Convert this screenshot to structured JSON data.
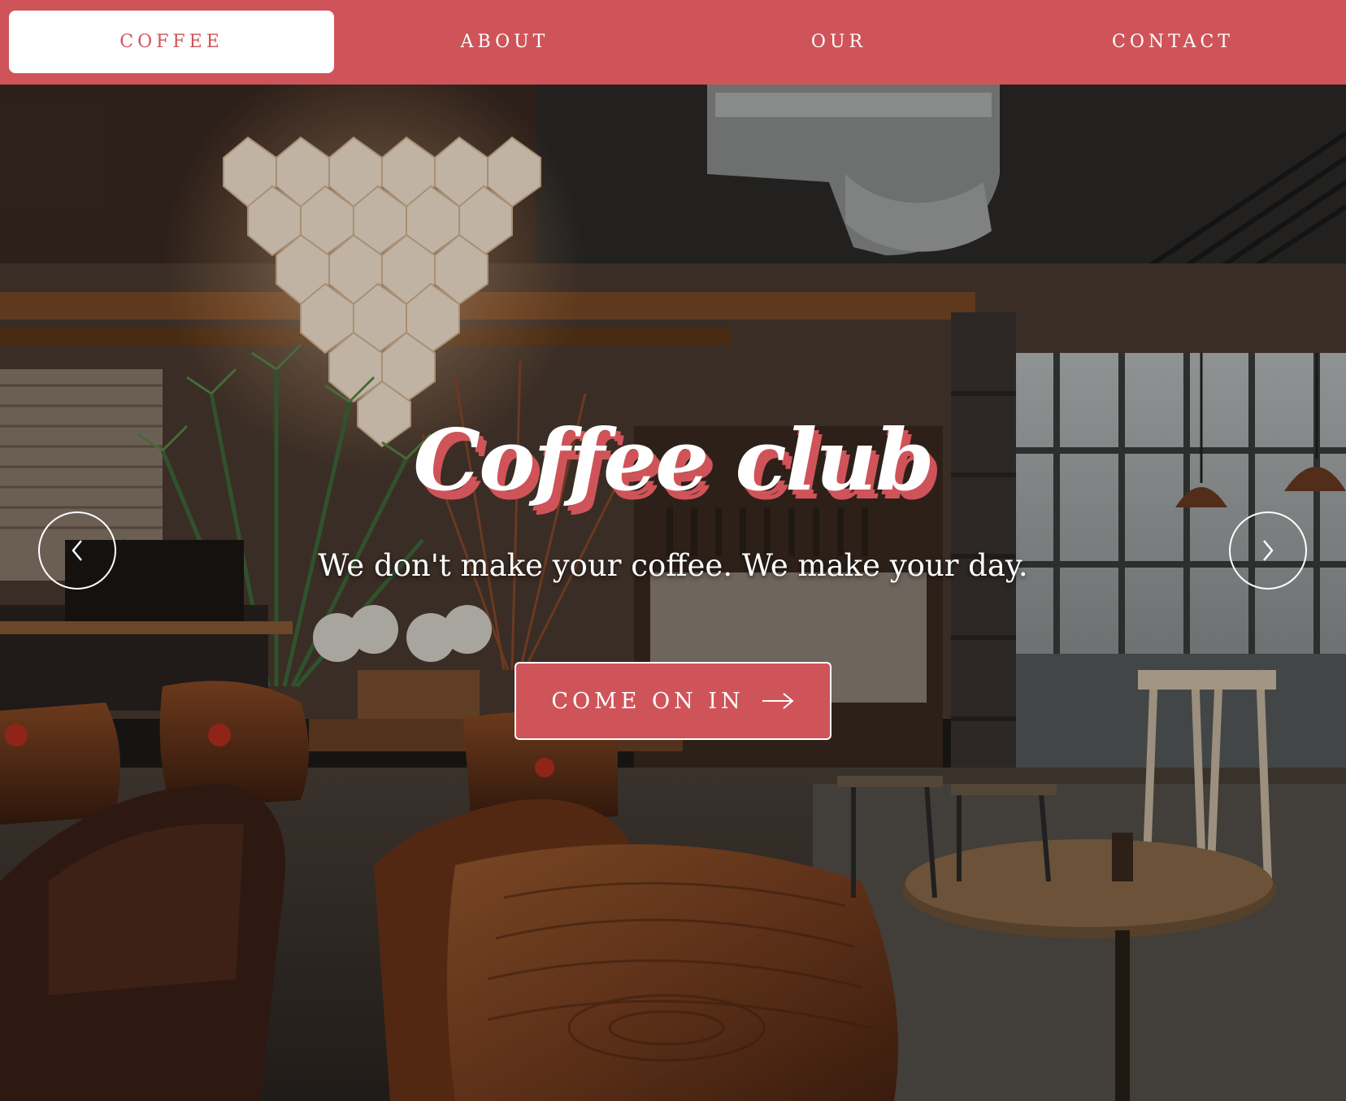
{
  "nav": {
    "items": [
      {
        "label": "COFFEE",
        "active": true
      },
      {
        "label": "ABOUT",
        "active": false
      },
      {
        "label": "OUR",
        "active": false
      },
      {
        "label": "CONTACT",
        "active": false
      }
    ]
  },
  "hero": {
    "title": "Coffee club",
    "subtitle": "We don't make your coffee. We make your day.",
    "cta_label": "COME ON IN",
    "cta_icon": "arrow-right-icon",
    "prev_icon": "chevron-left-icon",
    "next_icon": "chevron-right-icon",
    "background": "cafe-interior-photo"
  },
  "colors": {
    "accent": "#cf5459",
    "text_light": "#ffffff"
  }
}
